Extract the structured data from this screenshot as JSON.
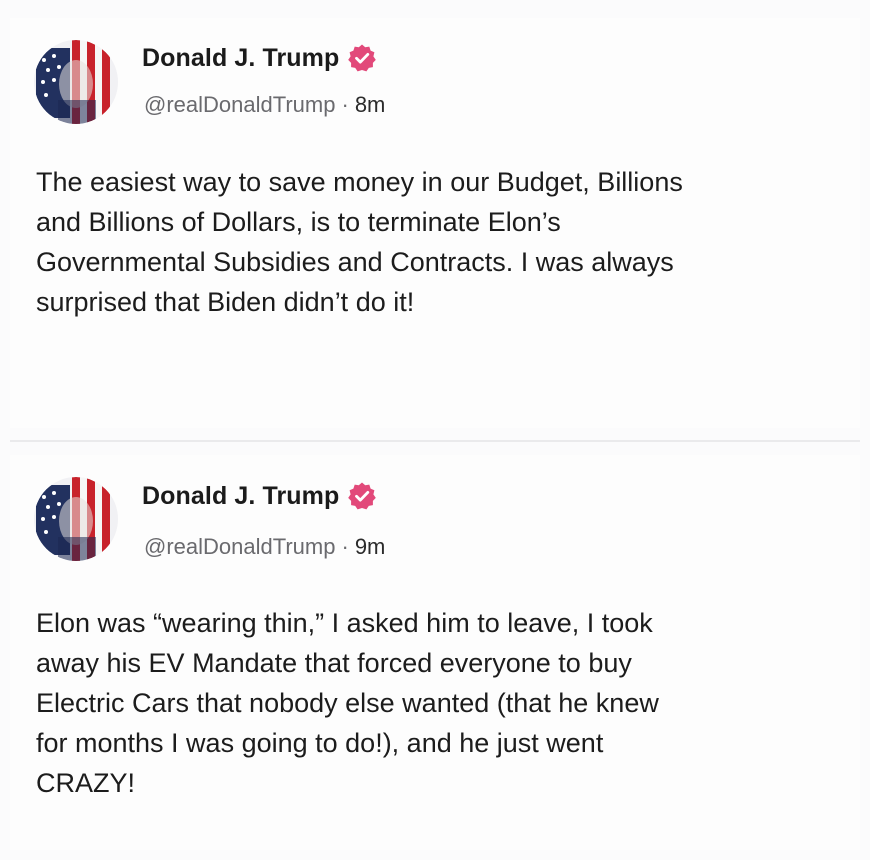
{
  "feed": {
    "posts": [
      {
        "author": {
          "display_name": "Donald J. Trump",
          "handle": "@realDonaldTrump",
          "verified": true,
          "verified_color": "#e2497a",
          "avatar_icon": "flag-portrait-avatar"
        },
        "timestamp": "8m",
        "separator": "·",
        "lines": [
          "The easiest way to save money in our Budget, Billions",
          "and Billions of Dollars, is to terminate Elon’s",
          "Governmental Subsidies and Contracts. I was always",
          "surprised that Biden didn’t do it!"
        ]
      },
      {
        "author": {
          "display_name": "Donald J. Trump",
          "handle": "@realDonaldTrump",
          "verified": true,
          "verified_color": "#e2497a",
          "avatar_icon": "flag-portrait-avatar"
        },
        "timestamp": "9m",
        "separator": "·",
        "lines": [
          "Elon was “wearing thin,” I asked him to leave, I took",
          "away his EV Mandate that forced everyone to buy",
          "Electric Cars that nobody else wanted (that he knew",
          "for months I was going to do!), and he just went",
          "CRAZY!"
        ]
      }
    ]
  }
}
